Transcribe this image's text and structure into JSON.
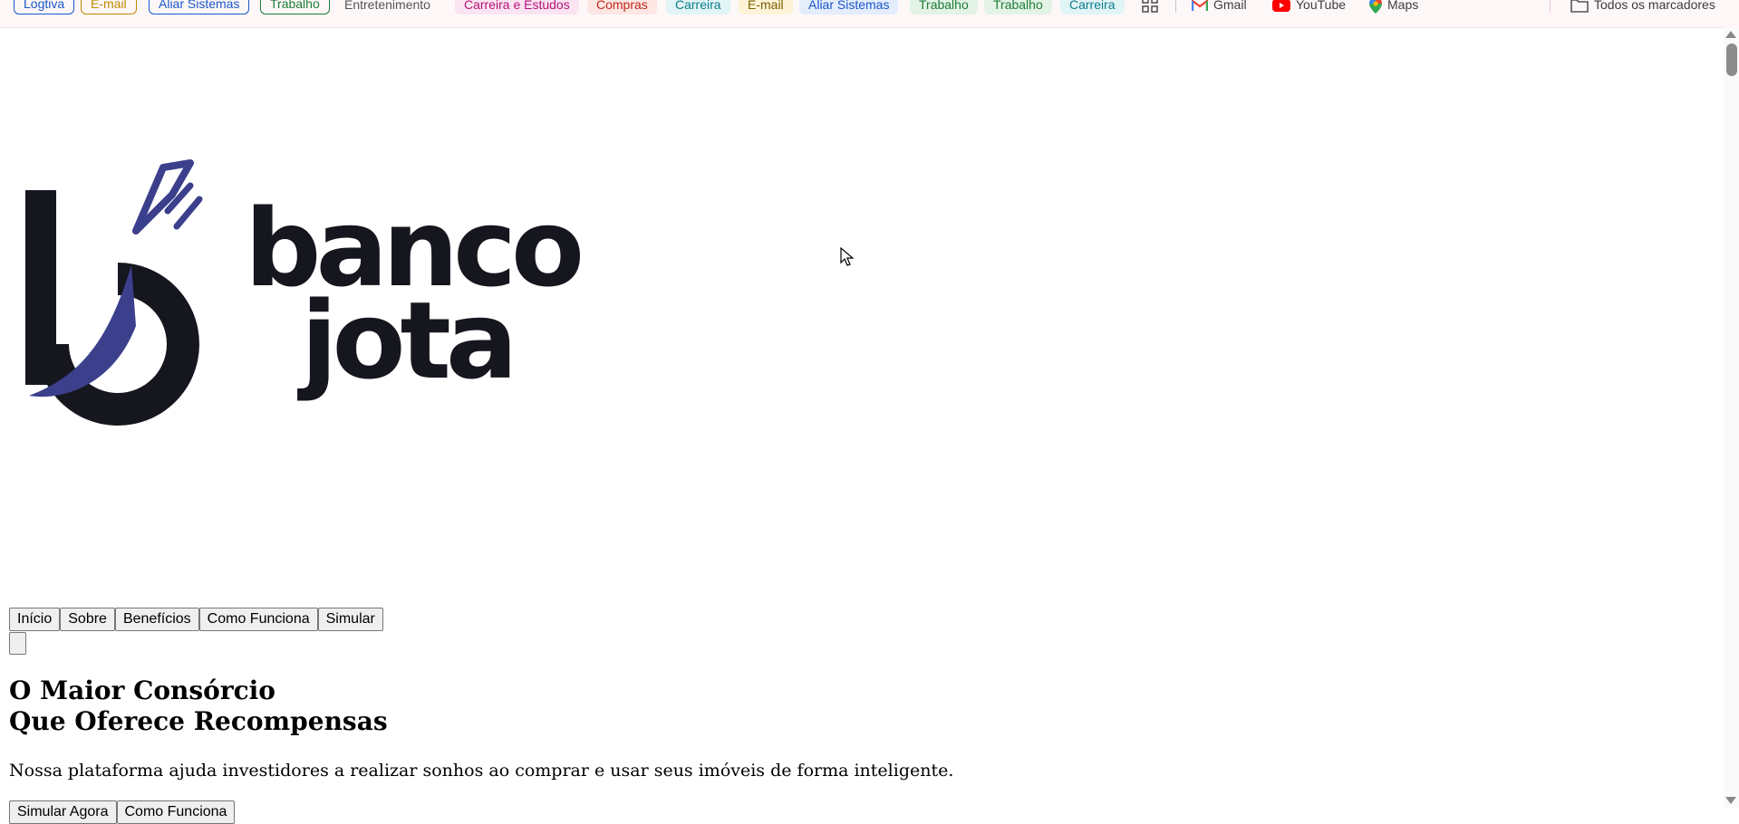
{
  "bookmarks": {
    "items": [
      {
        "label": "Logtiva",
        "style": "outlined",
        "color": "#1a57c8"
      },
      {
        "label": "E-mail",
        "style": "outlined",
        "color": "#c08a00"
      },
      {
        "label": "Aliar Sistemas",
        "style": "outlined",
        "color": "#1a57c8"
      },
      {
        "label": "Trabalho",
        "style": "outlined",
        "color": "#1e7c35"
      },
      {
        "label": "Entretenimento",
        "style": "plain",
        "color": "#555555"
      },
      {
        "label": "Carreira e Estudos",
        "style": "filled",
        "color": "#b5127a",
        "bg": "#fbe4f1"
      },
      {
        "label": "Compras",
        "style": "filled",
        "color": "#c0281b",
        "bg": "#fde6e3"
      },
      {
        "label": "Carreira",
        "style": "filled",
        "color": "#0e7d8c",
        "bg": "#e1f4f6"
      },
      {
        "label": "E-mail",
        "style": "filled",
        "color": "#7a5c00",
        "bg": "#fdf3d6"
      },
      {
        "label": "Aliar Sistemas",
        "style": "filled",
        "color": "#1a57c8",
        "bg": "#e4edfc"
      },
      {
        "label": "Trabalho",
        "style": "filled",
        "color": "#1e7c35",
        "bg": "#e3f3e6"
      },
      {
        "label": "Trabalho",
        "style": "filled",
        "color": "#1e7c35",
        "bg": "#e3f3e6"
      },
      {
        "label": "Carreira",
        "style": "filled",
        "color": "#0e7d8c",
        "bg": "#e1f4f6"
      }
    ],
    "links": [
      {
        "label": "Gmail",
        "icon": "gmail-icon"
      },
      {
        "label": "YouTube",
        "icon": "youtube-icon"
      },
      {
        "label": "Maps",
        "icon": "maps-icon"
      }
    ],
    "all_bookmarks_label": "Todos os marcadores"
  },
  "logo": {
    "line1": "banco",
    "line2": "jota",
    "colors": {
      "dark": "#16161f",
      "accent": "#3b3f8c"
    }
  },
  "nav": {
    "items": [
      "Início",
      "Sobre",
      "Benefícios",
      "Como Funciona",
      "Simular"
    ]
  },
  "hero": {
    "title_line1": "O Maior Consórcio",
    "title_line2": "Que Oferece Recompensas",
    "description": "Nossa plataforma ajuda investidores a realizar sonhos ao comprar e usar seus imóveis de forma inteligente.",
    "actions": [
      "Simular Agora",
      "Como Funciona"
    ]
  }
}
